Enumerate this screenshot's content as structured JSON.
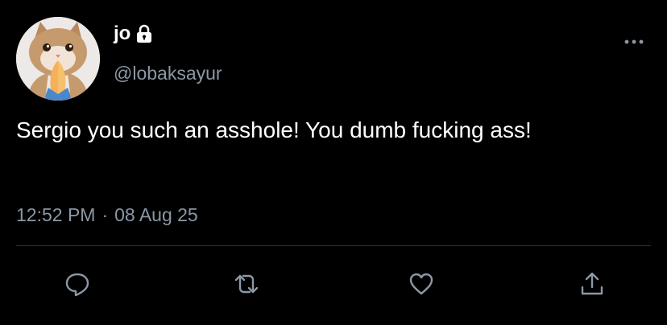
{
  "tweet": {
    "display_name": "jo",
    "handle": "@lobaksayur",
    "text": "Sergio you such an asshole! You dumb fucking ass!",
    "time": "12:52 PM",
    "separator": "·",
    "date": "08 Aug 25",
    "protected_icon": "lock-icon",
    "avatar": "cat-praying-hands-avatar"
  },
  "actions": [
    {
      "name": "reply",
      "icon": "speech-bubble-icon"
    },
    {
      "name": "retweet",
      "icon": "retweet-arrows-icon"
    },
    {
      "name": "like",
      "icon": "heart-icon"
    },
    {
      "name": "share",
      "icon": "share-upload-icon"
    }
  ],
  "colors": {
    "background": "#000000",
    "text": "#ffffff",
    "secondary": "#8b98a5",
    "divider": "#2f3336"
  }
}
